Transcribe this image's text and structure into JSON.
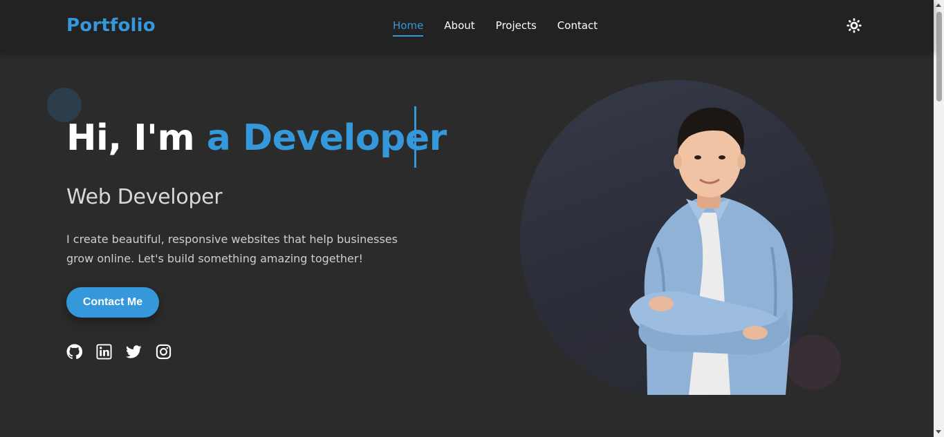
{
  "header": {
    "logo": "Portfolio",
    "nav": [
      {
        "label": "Home",
        "active": true
      },
      {
        "label": "About",
        "active": false
      },
      {
        "label": "Projects",
        "active": false
      },
      {
        "label": "Contact",
        "active": false
      }
    ],
    "theme_toggle_icon": "sun-icon"
  },
  "hero": {
    "title_prefix": "Hi, I'm",
    "title_highlight": "a Developer",
    "subtitle": "Web Developer",
    "description": "I create beautiful, responsive websites that help businesses grow online. Let's build something amazing together!",
    "cta_label": "Contact Me",
    "socials": [
      "github-icon",
      "linkedin-icon",
      "twitter-icon",
      "instagram-icon"
    ],
    "photo": "developer-portrait"
  },
  "colors": {
    "accent": "#3498db",
    "background": "#2b2b2b",
    "navbar": "#222222",
    "text": "#ffffff"
  }
}
